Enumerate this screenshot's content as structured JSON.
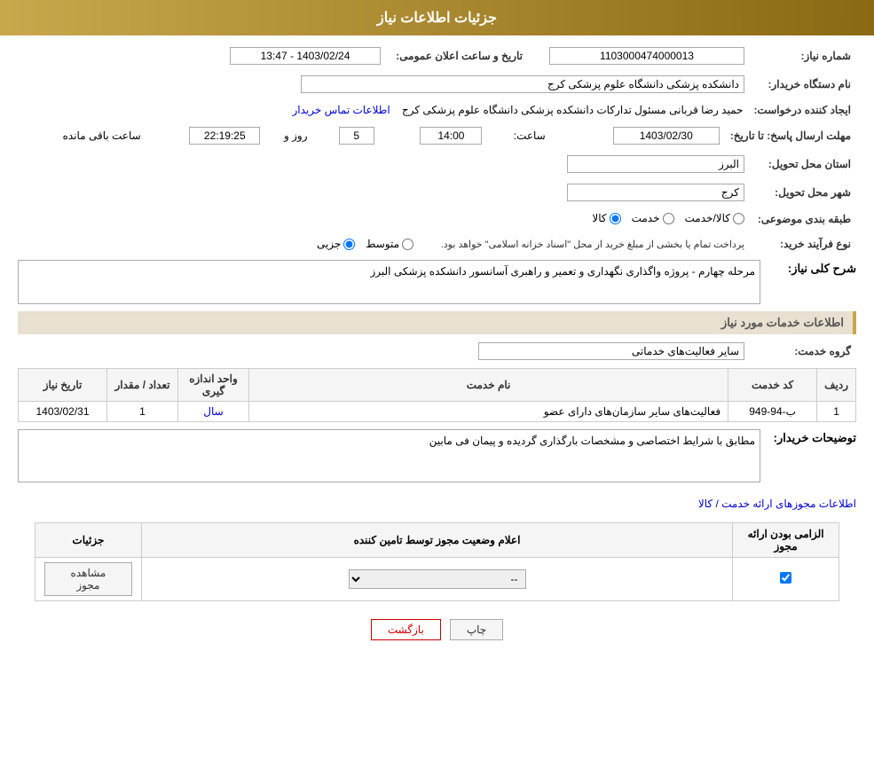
{
  "page": {
    "title": "جزئیات اطلاعات نیاز"
  },
  "header": {
    "title": "جزئیات اطلاعات نیاز"
  },
  "fields": {
    "need_number_label": "شماره نیاز:",
    "need_number_value": "1103000474000013",
    "announce_date_label": "تاریخ و ساعت اعلان عمومی:",
    "announce_date_value": "1403/02/24 - 13:47",
    "buyer_name_label": "نام دستگاه خریدار:",
    "buyer_name_value": "دانشکده پزشکی دانشگاه علوم پزشکی کرج",
    "creator_label": "ایجاد کننده درخواست:",
    "creator_value": "حمید رضا قربانی مسئول تدارکات دانشکده پزشکی دانشگاه علوم پزشکی کرج",
    "contact_link": "اطلاعات تماس خریدار",
    "response_deadline_label": "مهلت ارسال پاسخ: تا تاریخ:",
    "response_date_value": "1403/02/30",
    "response_time_label": "ساعت:",
    "response_time_value": "14:00",
    "response_day_label": "روز و",
    "response_day_value": "5",
    "response_hour_label": "ساعت باقی مانده",
    "response_remaining_value": "22:19:25",
    "province_label": "استان محل تحویل:",
    "province_value": "البرز",
    "city_label": "شهر محل تحویل:",
    "city_value": "کرج",
    "category_label": "طبقه بندی موضوعی:",
    "category_options": [
      "کالا",
      "خدمت",
      "کالا/خدمت"
    ],
    "category_selected": "کالا",
    "purchase_type_label": "نوع فرآیند خرید:",
    "purchase_options": [
      "جزیی",
      "متوسط"
    ],
    "purchase_note": "پرداخت تمام یا بخشی از مبلغ خرید از محل \"اسناد خزانه اسلامی\" خواهد بود.",
    "need_description_label": "شرح کلی نیاز:",
    "need_description_value": "مرحله چهارم - پروژه واگذاری نگهداری و تعمیر و راهبری آسانسور دانشکده پزشکی البرز",
    "services_section_title": "اطلاعات خدمات مورد نیاز",
    "service_group_label": "گروه خدمت:",
    "service_group_value": "سایر فعالیت‌های خدماتی",
    "table_headers": {
      "row_num": "ردیف",
      "service_code": "کد خدمت",
      "service_name": "نام خدمت",
      "unit": "واحد اندازه گیری",
      "count": "تعداد / مقدار",
      "date": "تاریخ نیاز"
    },
    "table_rows": [
      {
        "row_num": "1",
        "service_code": "ب-94-949",
        "service_name": "فعالیت‌های سایر سازمان‌های دارای عضو",
        "unit": "سال",
        "count": "1",
        "date": "1403/02/31"
      }
    ],
    "buyer_description_label": "توضیحات خریدار:",
    "buyer_description_value": "مطابق با شرایط اختصاصی و مشخصات بارگذاری گردیده و پیمان فی مابین",
    "permits_link": "اطلاعات مجوزهای ارائه خدمت / کالا",
    "permits_table": {
      "headers": {
        "mandatory": "الزامی بودن ارائه مجوز",
        "status_announce": "اعلام وضعیت مجوز توسط تامین کننده",
        "details": "جزئیات"
      },
      "rows": [
        {
          "mandatory": true,
          "status_value": "--",
          "details_btn": "مشاهده مجوز"
        }
      ]
    },
    "btn_print": "چاپ",
    "btn_back": "بازگشت"
  }
}
